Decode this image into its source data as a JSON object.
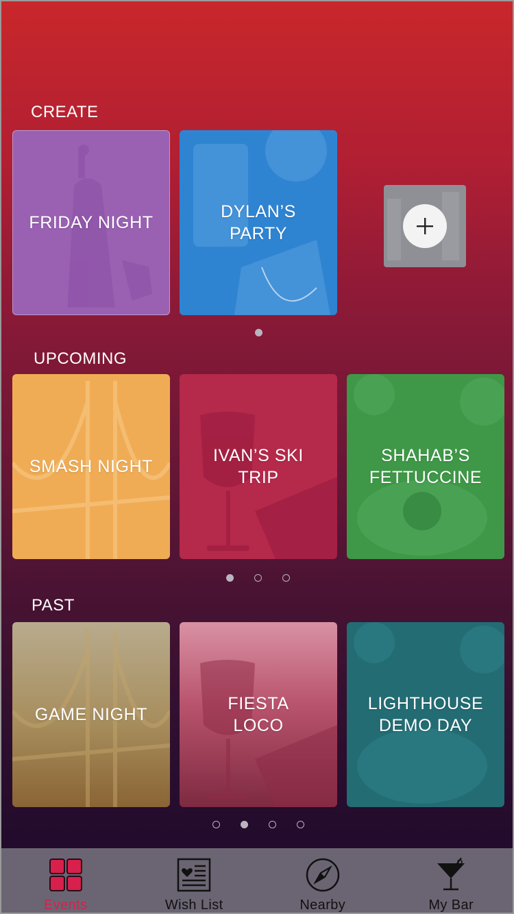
{
  "sections": {
    "create": {
      "title": "CREATE",
      "cards": [
        {
          "label": "FRIDAY NIGHT",
          "color": "#9a61b3"
        },
        {
          "label": "DYLAN’S PARTY",
          "color": "#2f84d2"
        }
      ],
      "add_label": "+"
    },
    "upcoming": {
      "title": "UPCOMING",
      "cards": [
        {
          "label": "SMASH NIGHT",
          "color": "#f0ac55"
        },
        {
          "label": "IVAN’S SKI TRIP",
          "color": "#b5294b"
        },
        {
          "label": "SHAHAB’S FETTUCCINE",
          "color": "#3e9847"
        }
      ]
    },
    "past": {
      "title": "PAST",
      "cards": [
        {
          "label": "GAME NIGHT",
          "color": "#a98449"
        },
        {
          "label": "FIESTA LOCO",
          "color": "#b8536c"
        },
        {
          "label": "LIGHTHOUSE DEMO DAY",
          "color": "#236c74"
        }
      ]
    }
  },
  "pagers": {
    "create": {
      "count": 1,
      "active": 0
    },
    "upcoming": {
      "count": 3,
      "active": 0
    },
    "past": {
      "count": 4,
      "active": 1
    }
  },
  "tabbar": {
    "tabs": [
      {
        "label": "Events",
        "icon": "events-grid-icon",
        "active": true
      },
      {
        "label": "Wish List",
        "icon": "wish-list-icon",
        "active": false
      },
      {
        "label": "Nearby",
        "icon": "compass-icon",
        "active": false
      },
      {
        "label": "My Bar",
        "icon": "cocktail-glass-icon",
        "active": false
      }
    ],
    "accent": "#d7204c"
  }
}
